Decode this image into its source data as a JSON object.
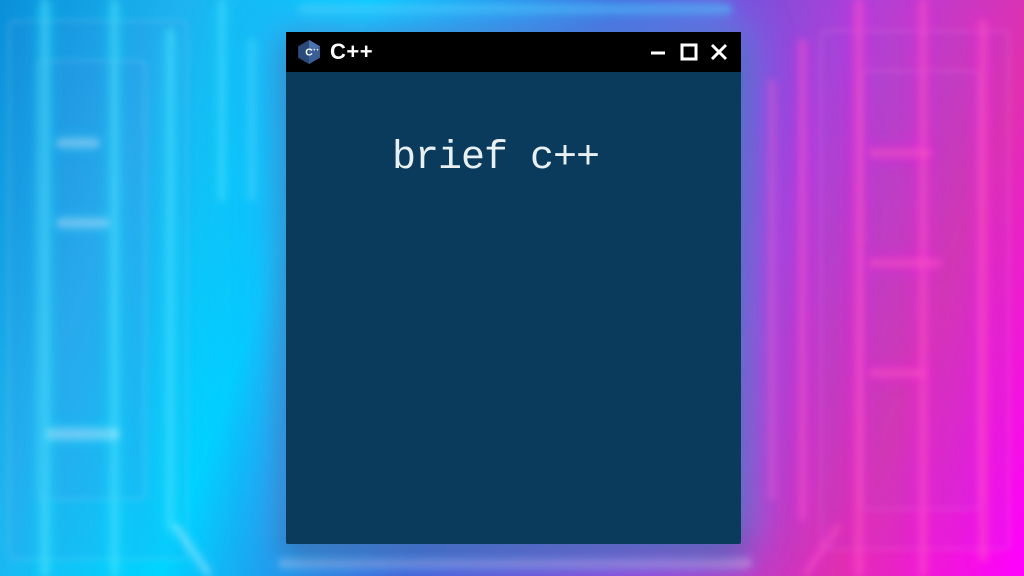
{
  "window": {
    "title": "C++",
    "icon_name": "cpp-icon"
  },
  "terminal": {
    "output": "brief c++"
  },
  "colors": {
    "window_bg": "#0a3b5c",
    "titlebar": "#000000",
    "text": "#e8f0f2"
  }
}
